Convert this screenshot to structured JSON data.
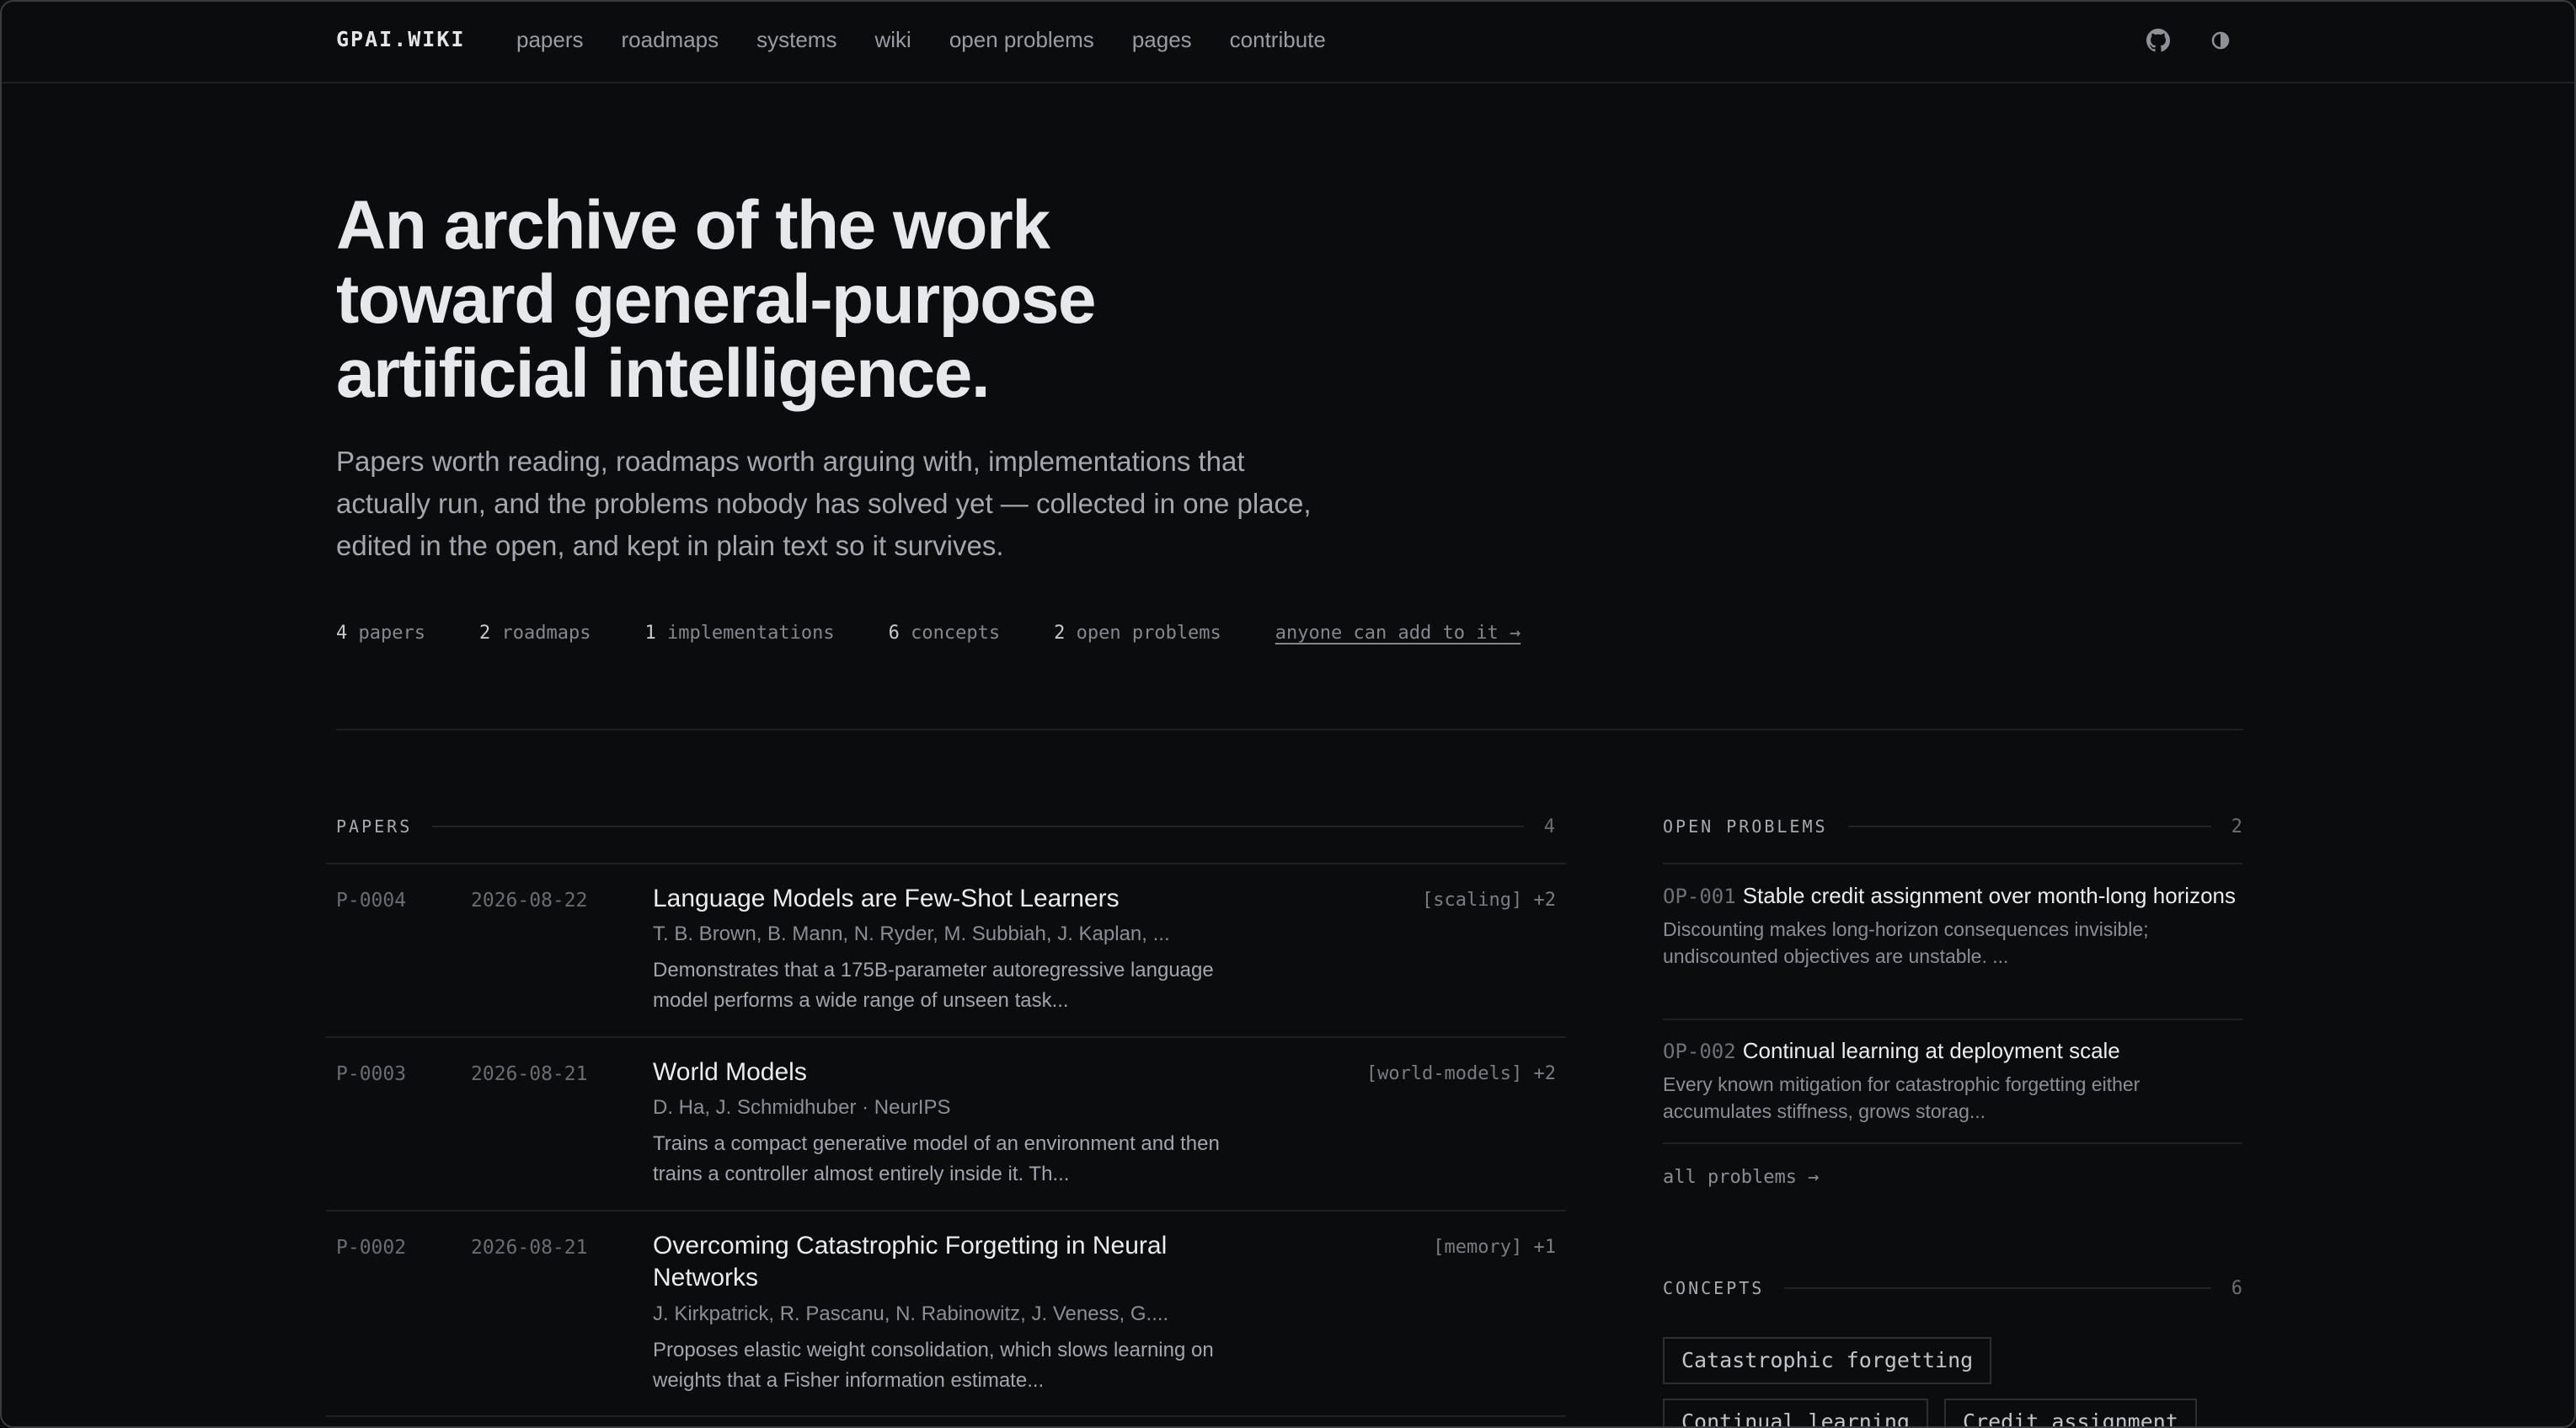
{
  "brand": "GPAI.WIKI",
  "nav": [
    "papers",
    "roadmaps",
    "systems",
    "wiki",
    "open problems",
    "pages",
    "contribute"
  ],
  "icons": {
    "github": "github-icon",
    "theme": "theme-toggle-icon"
  },
  "hero": {
    "title_lines": [
      "An archive of the work",
      "toward general-purpose",
      "artificial intelligence."
    ],
    "subtitle": "Papers worth reading, roadmaps worth arguing with, implementations that actually run, and the problems nobody has solved yet — collected in one place, edited in the open, and kept in plain text so it survives."
  },
  "stats": [
    {
      "n": "4",
      "label": "papers"
    },
    {
      "n": "2",
      "label": "roadmaps"
    },
    {
      "n": "1",
      "label": "implementations"
    },
    {
      "n": "6",
      "label": "concepts"
    },
    {
      "n": "2",
      "label": "open problems"
    }
  ],
  "add_link": "anyone can add to it →",
  "papers_section": {
    "label": "PAPERS",
    "count": "4"
  },
  "papers": [
    {
      "id": "P-0004",
      "date": "2026-08-22",
      "title": "Language Models are Few-Shot Learners",
      "authors": "T. B. Brown, B. Mann, N. Ryder, M. Subbiah, J. Kaplan, ...",
      "desc": "Demonstrates that a 175B-parameter autoregressive language model performs a wide range of unseen task...",
      "tags": "[scaling] +2"
    },
    {
      "id": "P-0003",
      "date": "2026-08-21",
      "title": "World Models",
      "authors": "D. Ha, J. Schmidhuber · NeurIPS",
      "desc": "Trains a compact generative model of an environment and then trains a controller almost entirely inside it. Th...",
      "tags": "[world-models] +2"
    },
    {
      "id": "P-0002",
      "date": "2026-08-21",
      "title": "Overcoming Catastrophic Forgetting in Neural Networks",
      "authors": "J. Kirkpatrick, R. Pascanu, N. Rabinowitz, J. Veness, G....",
      "desc": "Proposes elastic weight consolidation, which slows learning on weights that a Fisher information estimate...",
      "tags": "[memory] +1"
    }
  ],
  "problems_section": {
    "label": "OPEN PROBLEMS",
    "count": "2"
  },
  "problems": [
    {
      "id": "OP-001",
      "title": "Stable credit assignment over month-long horizons",
      "desc": "Discounting makes long-horizon consequences invisible; undiscounted objectives are unstable. ..."
    },
    {
      "id": "OP-002",
      "title": "Continual learning at deployment scale",
      "desc": "Every known mitigation for catastrophic forgetting either accumulates stiffness, grows storag..."
    }
  ],
  "all_problems": "all problems →",
  "concepts_section": {
    "label": "CONCEPTS",
    "count": "6"
  },
  "concepts": [
    "Catastrophic forgetting",
    "Continual learning",
    "Credit assignment"
  ]
}
